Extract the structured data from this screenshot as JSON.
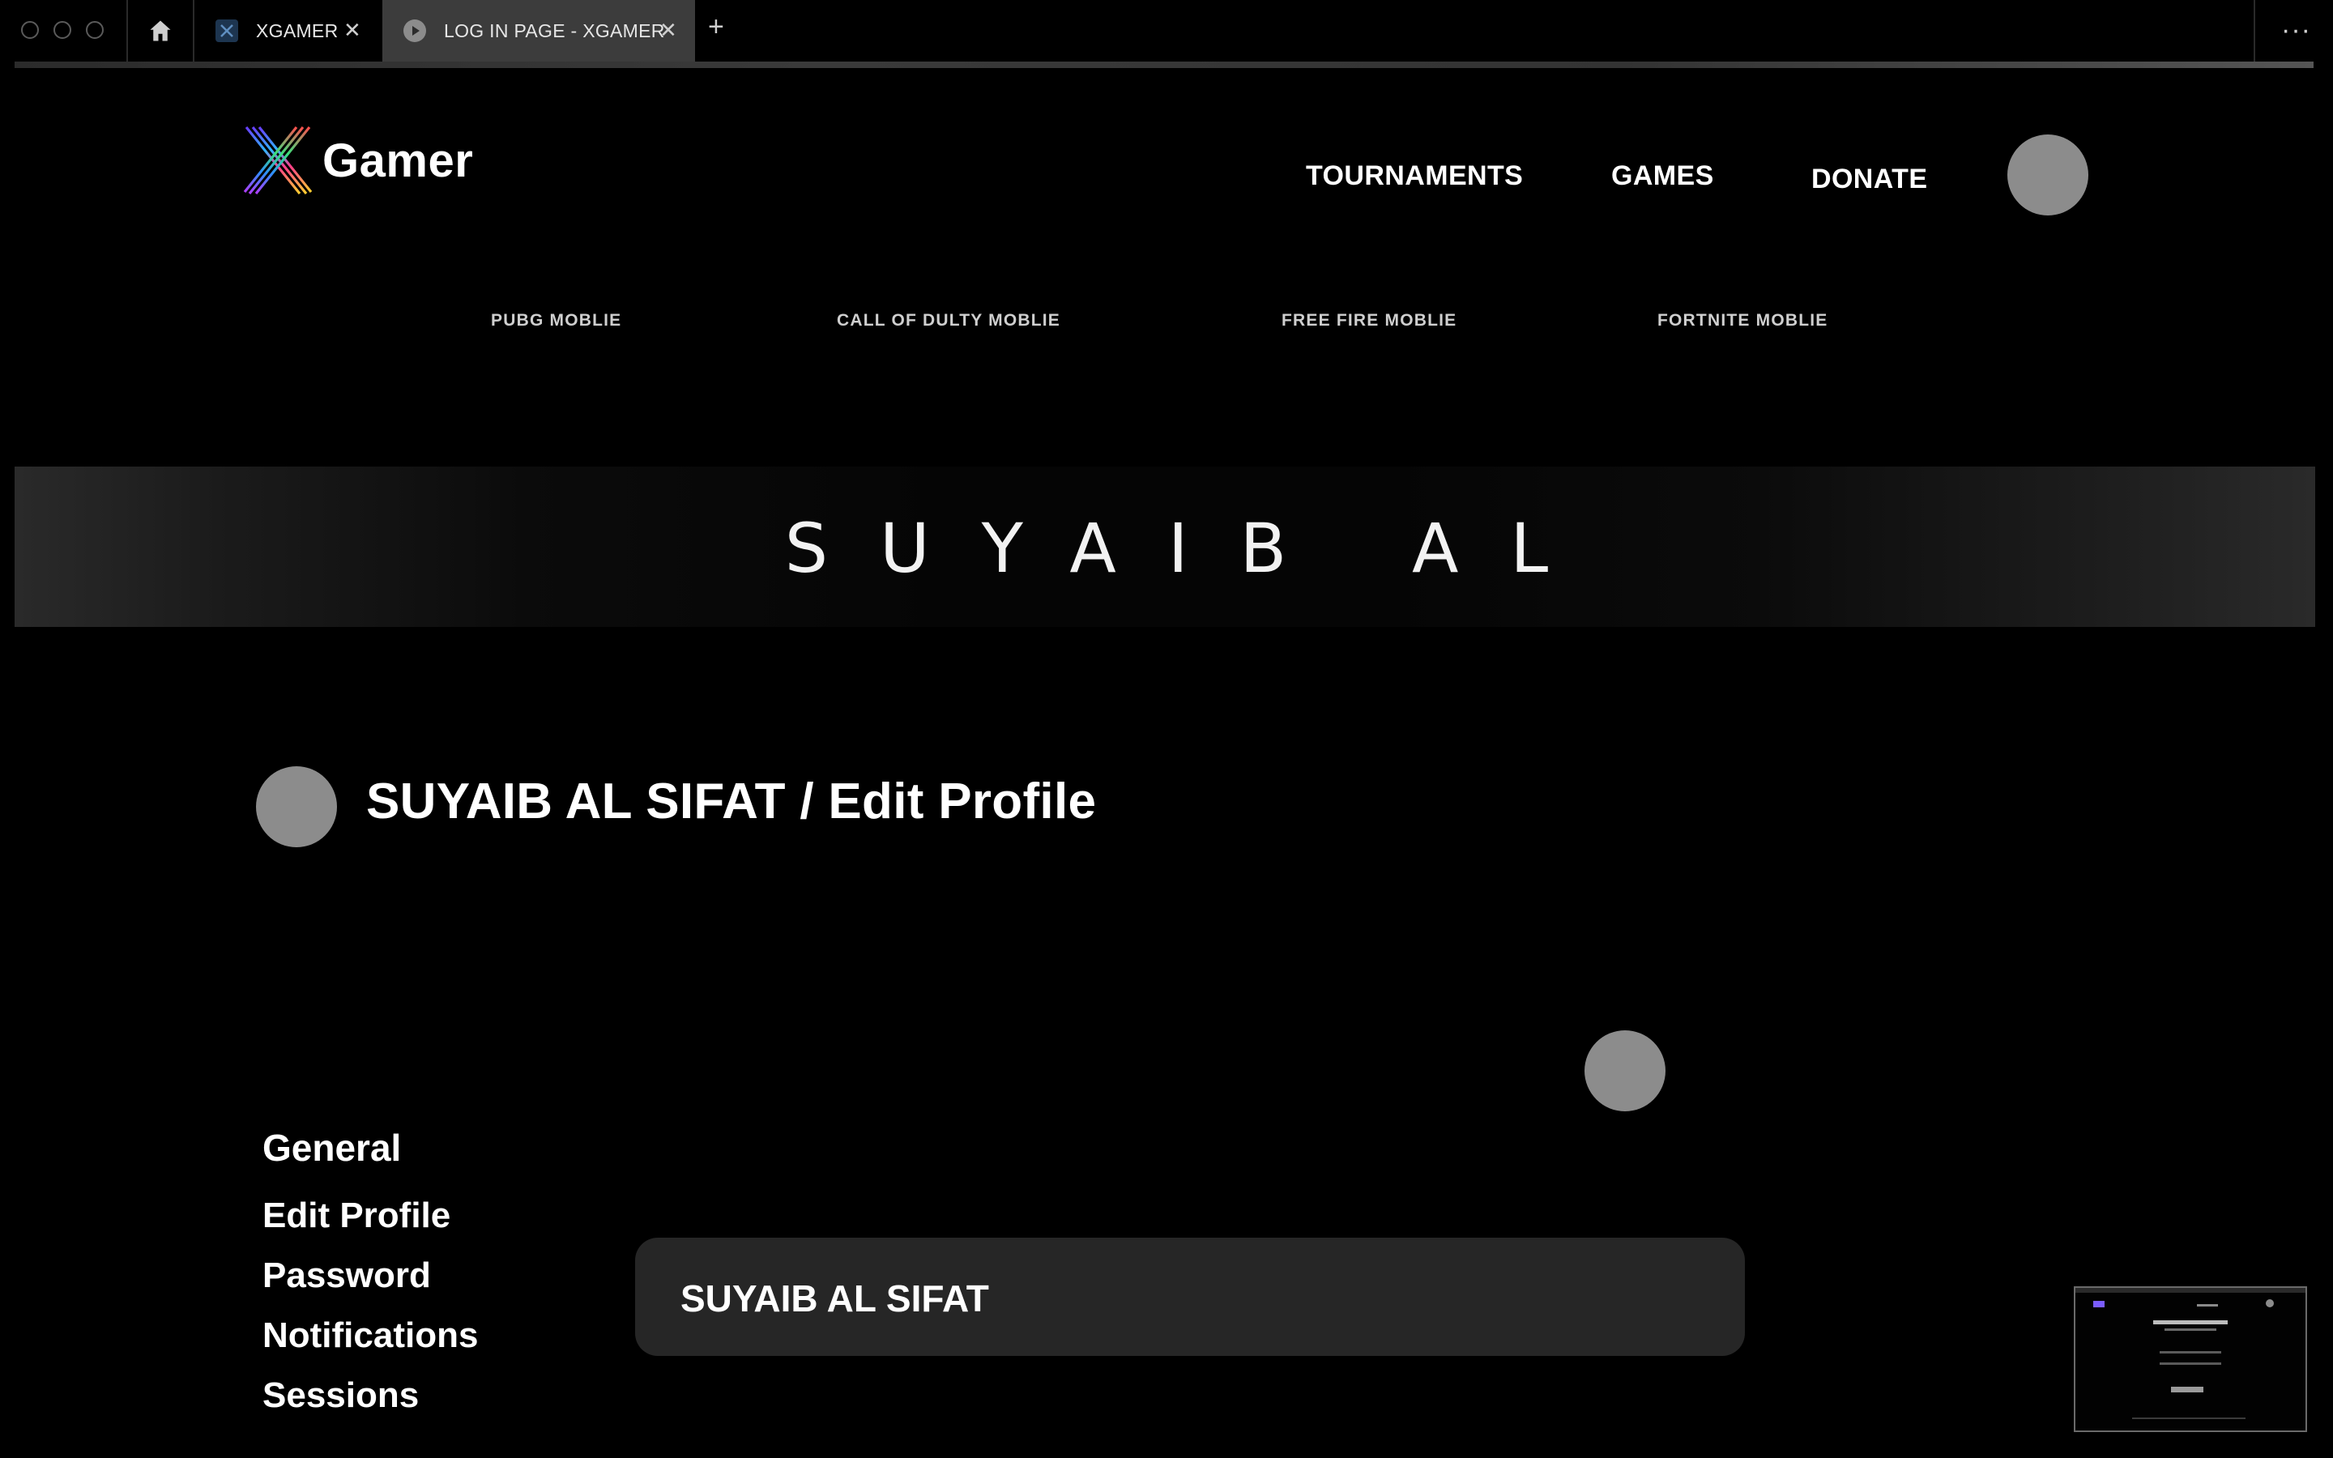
{
  "browser": {
    "tabs": [
      {
        "title": "XGAMER",
        "active": false
      },
      {
        "title": "LOG IN PAGE - XGAMER",
        "active": true
      }
    ],
    "icons": {
      "home": "home-icon",
      "close": "close-icon",
      "new_tab": "plus-icon",
      "more": "more-icon"
    },
    "close_glyph": "✕",
    "new_tab_glyph": "+",
    "more_glyph": "···"
  },
  "site": {
    "logo_text": "Gamer",
    "nav": {
      "tournaments": "TOURNAMENTS",
      "games": "GAMES",
      "donate": "DONATE"
    },
    "games_menu": [
      "PUBG MOBLIE",
      "CALL OF DULTY MOBLIE",
      "FREE FIRE MOBLIE",
      "FORTNITE MOBLIE"
    ]
  },
  "banner": {
    "text": "SUYAIB AL"
  },
  "profile": {
    "title": "SUYAIB AL SIFAT / Edit Profile",
    "name_value": "SUYAIB AL SIFAT"
  },
  "settings": {
    "heading": "General",
    "items": [
      "Edit Profile",
      "Password",
      "Notifications",
      "Sessions"
    ]
  },
  "colors": {
    "background": "#000000",
    "avatar_placeholder": "#8c8c8c",
    "field_background": "#262626",
    "active_tab": "#3c3c3c"
  }
}
